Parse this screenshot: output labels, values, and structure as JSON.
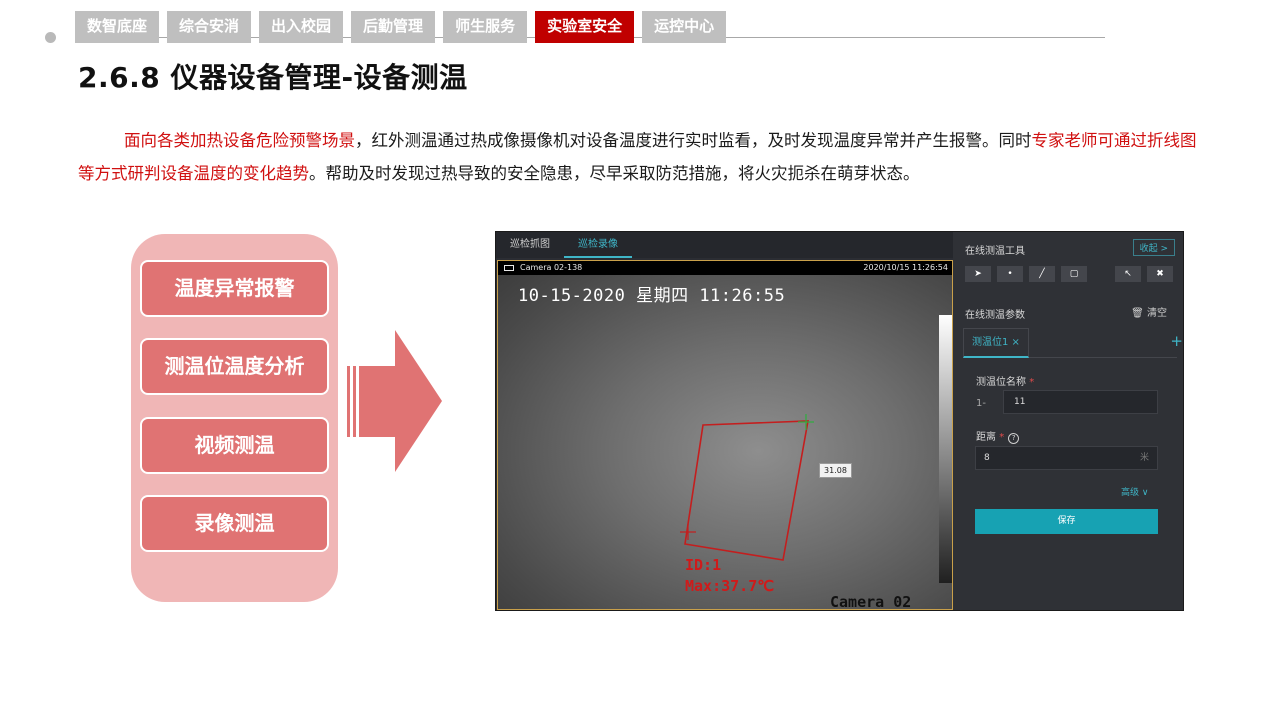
{
  "nav": {
    "tabs": [
      {
        "label": "数智底座"
      },
      {
        "label": "综合安消"
      },
      {
        "label": "出入校园"
      },
      {
        "label": "后勤管理"
      },
      {
        "label": "师生服务"
      },
      {
        "label": "实验室安全",
        "active": true
      },
      {
        "label": "运控中心"
      }
    ]
  },
  "title": "2.6.8 仪器设备管理-设备测温",
  "description": {
    "part1_red": "面向各类加热设备危险预警场景",
    "part2": "，红外测温通过热成像摄像机对设备温度进行实时监看，及时发现温度异常并产生报警。同时",
    "part3_red": "专家老师可通过折线图等方式研判设备温度的变化趋势",
    "part4": "。帮助及时发现过热导致的安全隐患，尽早采取防范措施，将火灾扼杀在萌芽状态。"
  },
  "features": [
    "温度异常报警",
    "测温位温度分析",
    "视频测温",
    "录像测温"
  ],
  "app": {
    "tabs": [
      "巡检抓图",
      "巡检录像"
    ],
    "active_tab": "巡检录像",
    "video": {
      "camera_name": "Camera 02-138",
      "timestamp": "2020/10/15 11:26:54",
      "osd_time": "10-15-2020 星期四 11:26:55",
      "region_id": "ID:1",
      "region_max": "Max:37.7℃",
      "camera_label": "Camera 02",
      "temp_tag": "31.08"
    },
    "panel": {
      "tool_title": "在线测温工具",
      "collapse_label": "收起 >",
      "tools": [
        "pointer-icon",
        "point-icon",
        "line-icon",
        "rect-icon",
        "select-icon",
        "trash-icon"
      ],
      "param_title": "在线测温参数",
      "clear_label": "🗑 清空",
      "position_tab": "测温位1  ×",
      "add_symbol": "+",
      "name_label": "测温位名称",
      "required_mark": "*",
      "name_prefix": "1-",
      "name_value": "11",
      "distance_label": "距离",
      "help_symbol": "?",
      "distance_value": "8",
      "distance_unit": "米",
      "advanced_label": "高级 ∨",
      "save_label": "保存"
    }
  },
  "colors": {
    "accent_red": "#c00000",
    "nav_gray": "#bfbfbf",
    "feature_bg": "#f0b6b6",
    "feature_btn": "#e07373",
    "teal": "#17a2b3"
  }
}
